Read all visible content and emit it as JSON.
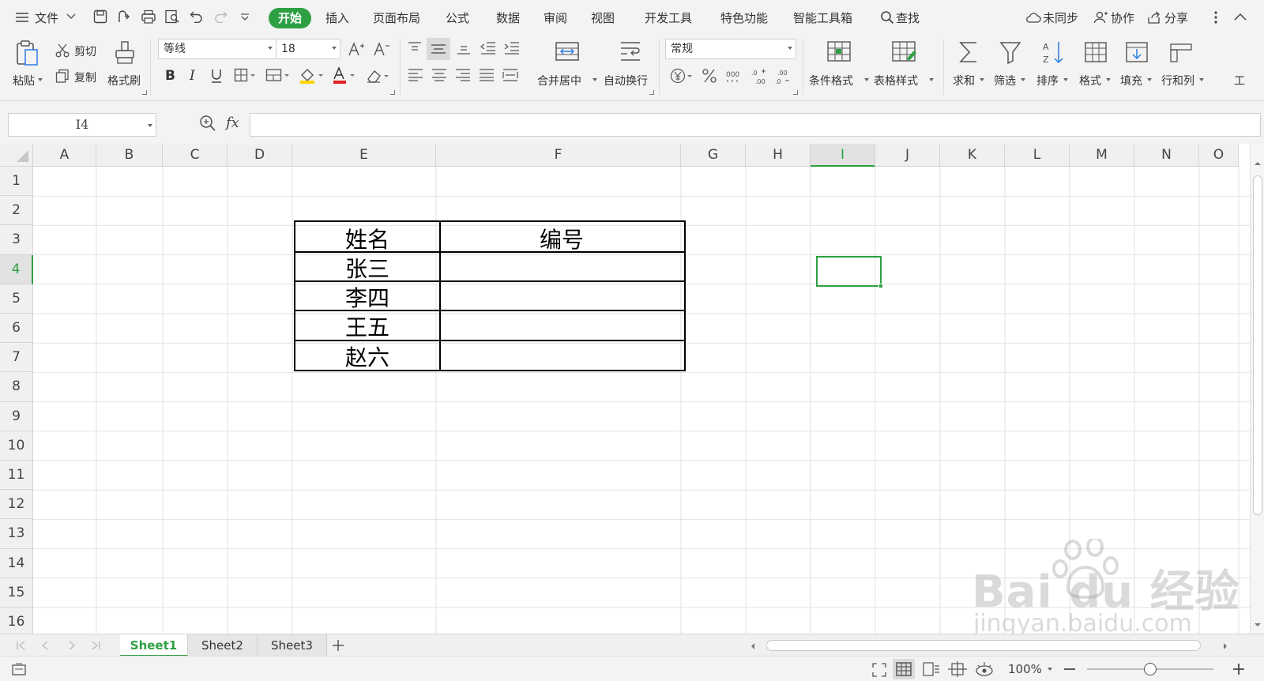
{
  "menubar": {
    "file": "文件",
    "tabs": [
      "开始",
      "插入",
      "页面布局",
      "公式",
      "数据",
      "审阅",
      "视图",
      "开发工具",
      "特色功能",
      "智能工具箱"
    ],
    "search": "查找",
    "unsynced": "未同步",
    "collab": "协作",
    "share": "分享"
  },
  "ribbon": {
    "paste": "粘贴",
    "cut": "剪切",
    "copy": "复制",
    "format_painter": "格式刷",
    "font_name": "等线",
    "font_size": "18",
    "merge_center": "合并居中",
    "wrap_text": "自动换行",
    "number_format": "常规",
    "cond_format": "条件格式",
    "table_style": "表格样式",
    "sum": "求和",
    "filter": "筛选",
    "sort": "排序",
    "format": "格式",
    "fill": "填充",
    "row_col": "行和列",
    "work": "工"
  },
  "formula_bar": {
    "name_box": "I4",
    "fx": "fx",
    "content": ""
  },
  "grid": {
    "columns": [
      "A",
      "B",
      "C",
      "D",
      "E",
      "F",
      "G",
      "H",
      "I",
      "J",
      "K",
      "L",
      "M",
      "N",
      "O"
    ],
    "rows": [
      "1",
      "2",
      "3",
      "4",
      "5",
      "6",
      "7",
      "8",
      "9",
      "10",
      "11",
      "12",
      "13",
      "14",
      "15",
      "16"
    ],
    "active_cell": "I4",
    "table": {
      "header": [
        "姓名",
        "编号"
      ],
      "names": [
        "张三",
        "李四",
        "王五",
        "赵六"
      ]
    }
  },
  "sheets": {
    "tabs": [
      "Sheet1",
      "Sheet2",
      "Sheet3"
    ],
    "active": "Sheet1"
  },
  "status": {
    "zoom": "100%"
  },
  "watermark": {
    "brand": "Bai du 经验",
    "url": "jingyan.baidu.com"
  },
  "colors": {
    "accent": "#2ea043",
    "grid_line": "#e2e2e2",
    "header_bg": "#f0f0f0"
  }
}
